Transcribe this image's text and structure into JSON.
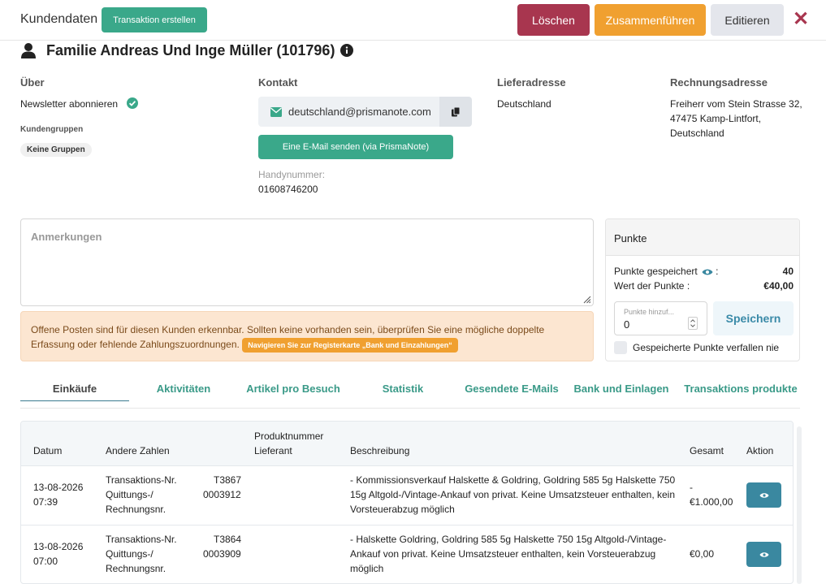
{
  "header": {
    "title": "Kundendaten",
    "create_tx_label": "Transaktion erstellen",
    "delete_label": "Löschen",
    "merge_label": "Zusammenführen",
    "edit_label": "Editieren",
    "close_glyph": "✕"
  },
  "customer": {
    "name": "Familie Andreas Und Inge Müller (101796)"
  },
  "about": {
    "heading": "Über",
    "newsletter": "Newsletter abonnieren",
    "groups_heading": "Kundengruppen",
    "groups_value": "Keine Gruppen"
  },
  "contact": {
    "heading": "Kontakt",
    "email": "deutschland@prismanote.com",
    "send_mail_label": "Eine E-Mail senden (via PrismaNote)",
    "phone_label": "Handynummer:",
    "phone": "01608746200"
  },
  "delivery": {
    "heading": "Lieferadresse",
    "line1": "Deutschland"
  },
  "billing": {
    "heading": "Rechnungsadresse",
    "line1": "Freiherr vom Stein Strasse 32,",
    "line2": "47475 Kamp-Lintfort,",
    "line3": "Deutschland"
  },
  "notes": {
    "placeholder": "Anmerkungen"
  },
  "alert": {
    "text": "Offene Posten sind für diesen Kunden erkennbar. Sollten keine vorhanden sein, überprüfen Sie eine mögliche doppelte Erfassung oder fehlende Zahlungszuordnungen.",
    "button": "Navigieren Sie zur Registerkarte „Bank und Einzahlungen“"
  },
  "points": {
    "title": "Punkte",
    "saved_label": "Punkte gespeichert",
    "saved_value": "40",
    "worth_label": "Wert der Punkte :",
    "worth_value": "€40,00",
    "input_label": "Punkte hinzuf...",
    "input_value": "0",
    "save_label": "Speichern",
    "never_expire_label": "Gespeicherte Punkte verfallen nie"
  },
  "tabs": [
    {
      "label": "Einkäufe"
    },
    {
      "label": "Aktivitäten"
    },
    {
      "label": "Artikel pro Besuch"
    },
    {
      "label": "Statistik"
    },
    {
      "label": "Gesendete E-Mails"
    },
    {
      "label": "Bank und Einlagen"
    },
    {
      "label": "Transaktions produkte"
    }
  ],
  "table": {
    "headers": {
      "date": "Datum",
      "other_numbers": "Andere Zahlen",
      "product_number": "Produktnummer",
      "supplier": "Lieferant",
      "description": "Beschreibung",
      "total": "Gesamt",
      "action": "Aktion"
    },
    "rows": [
      {
        "date": "13-08-2026",
        "time": "07:39",
        "tx_label": "Transaktions-Nr.",
        "tx_value": "T3867",
        "receipt_label_1": "Quittungs-/",
        "receipt_label_2": "Rechnungsnr.",
        "receipt_value": "0003912",
        "desc1": "- Kommissionsverkauf Halskette & Goldring, Goldring 585 5g Halskette 750",
        "desc2": "15g Altgold-/Vintage-Ankauf von privat. Keine Umsatzsteuer enthalten, kein",
        "desc3": "Vorsteuerabzug möglich",
        "total1": "-",
        "total2": "€1.000,00"
      },
      {
        "date": "13-08-2026",
        "time": "07:00",
        "tx_label": "Transaktions-Nr.",
        "tx_value": "T3864",
        "receipt_label_1": "Quittungs-/",
        "receipt_label_2": "Rechnungsnr.",
        "receipt_value": "0003909",
        "desc1": "- Halskette Goldring, Goldring 585 5g Halskette 750 15g Altgold-/Vintage-",
        "desc2": "Ankauf von privat. Keine Umsatzsteuer enthalten, kein Vorsteuerabzug",
        "desc3": "möglich",
        "total1": "€0,00",
        "total2": ""
      }
    ]
  },
  "colors": {
    "primary_green": "#3aa88a",
    "danger": "#a8364f",
    "warning": "#f0a030",
    "action_blue": "#3a88a0"
  },
  "icons": [
    "user-icon",
    "info-icon",
    "check-circle-icon",
    "envelope-icon",
    "copy-icon",
    "eye-icon",
    "close-icon",
    "resize-grip-icon"
  ]
}
